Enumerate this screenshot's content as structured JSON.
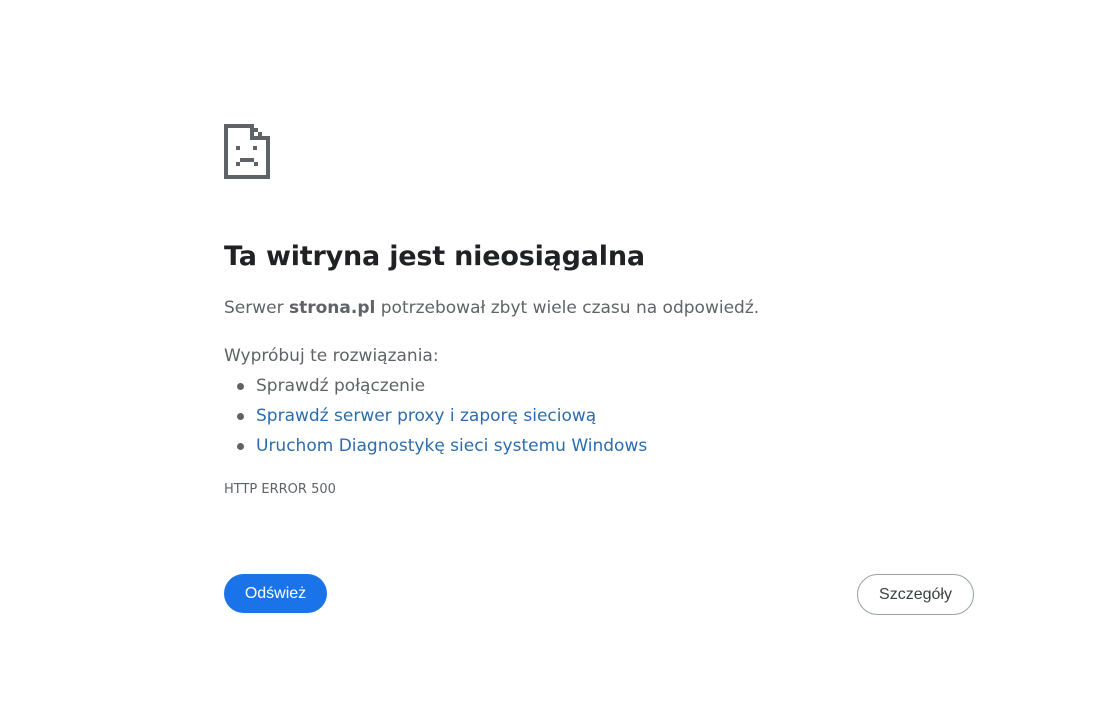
{
  "icon": "sad-document-icon",
  "heading": "Ta witryna jest nieosiągalna",
  "message": {
    "prefix": "Serwer ",
    "host": "strona.pl",
    "suffix": " potrzebował zbyt wiele czasu na odpowiedź."
  },
  "suggestions": {
    "heading": "Wypróbuj te rozwiązania:",
    "items": [
      {
        "label": "Sprawdź połączenie",
        "is_link": false
      },
      {
        "label": "Sprawdź serwer proxy i zaporę sieciową",
        "is_link": true
      },
      {
        "label": "Uruchom Diagnostykę sieci systemu Windows",
        "is_link": true
      }
    ]
  },
  "error_code": "HTTP ERROR 500",
  "buttons": {
    "reload_label": "Odśwież",
    "details_label": "Szczegóły"
  },
  "colors": {
    "primary_button": "#1a73e8",
    "link": "#2b6cb0",
    "heading": "#202124",
    "body_text": "#5f6368"
  }
}
